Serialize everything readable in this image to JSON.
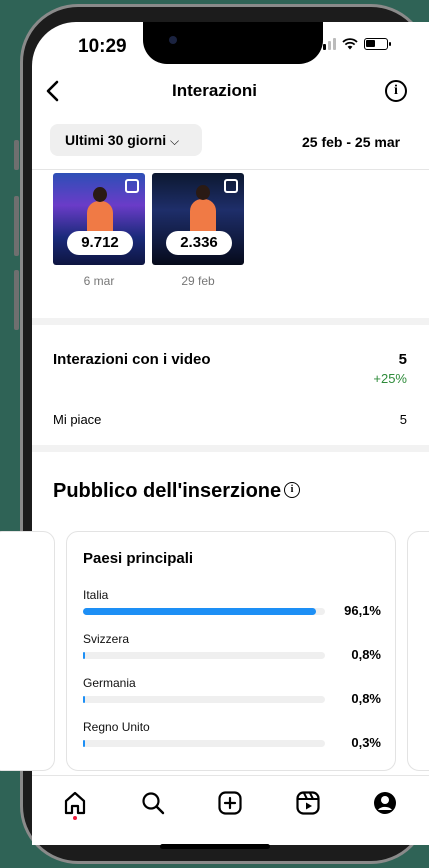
{
  "status_bar": {
    "time": "10:29"
  },
  "header": {
    "title": "Interazioni",
    "back_icon": "chevron-left-icon",
    "info_icon": "info-icon"
  },
  "filter": {
    "period_label": "Ultimi 30 giorni",
    "chevron": "⌵",
    "date_range": "25 feb - 25 mar"
  },
  "thumbnails": [
    {
      "value": "9.712",
      "date": "6 mar"
    },
    {
      "value": "2.336",
      "date": "29 feb"
    }
  ],
  "video_interactions": {
    "title": "Interazioni con i video",
    "value": "5",
    "change": "+25%",
    "rows": [
      {
        "label": "Mi piace",
        "value": "5"
      }
    ]
  },
  "audience": {
    "title": "Pubblico dell'inserzione",
    "top_countries": {
      "title": "Paesi principali",
      "items": [
        {
          "name": "Italia",
          "pct_label": "96,1%",
          "pct": 96.1
        },
        {
          "name": "Svizzera",
          "pct_label": "0,8%",
          "pct": 0.8
        },
        {
          "name": "Germania",
          "pct_label": "0,8%",
          "pct": 0.8
        },
        {
          "name": "Regno Unito",
          "pct_label": "0,3%",
          "pct": 0.3
        }
      ]
    }
  },
  "tabbar": {
    "active": "home",
    "icons": [
      "home-icon",
      "search-icon",
      "create-icon",
      "reels-icon",
      "profile-icon"
    ]
  },
  "colors": {
    "bar_fill": "#1d8ff5",
    "positive_change": "#2e8b3a",
    "background": "#2f6356"
  }
}
